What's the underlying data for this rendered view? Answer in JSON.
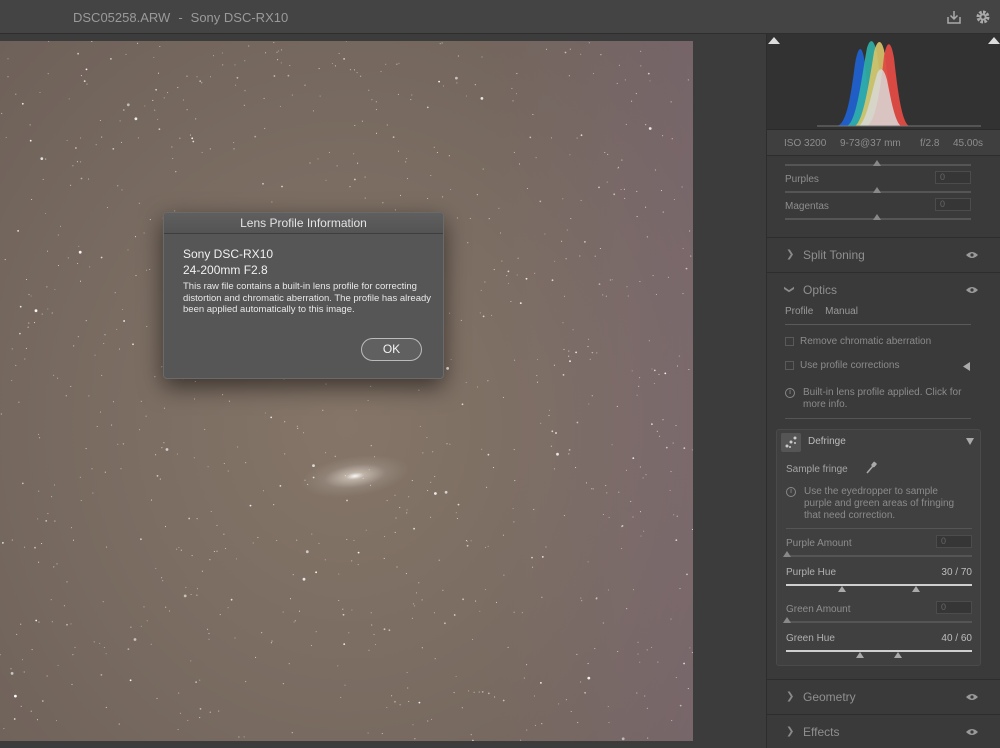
{
  "titlebar": {
    "filename": "DSC05258.ARW",
    "separator": "-",
    "camera": "Sony DSC-RX10",
    "export_icon": "export-icon",
    "settings_icon": "gear-icon"
  },
  "dialog": {
    "title": "Lens Profile Information",
    "camera": "Sony DSC-RX10",
    "lens": "24-200mm F2.8",
    "message": "This raw file contains a built-in lens profile for correcting distortion and chromatic aberration. The profile has already been applied automatically to this image.",
    "ok_label": "OK"
  },
  "exif": {
    "iso": "ISO 3200",
    "focal": "9-73@37 mm",
    "aperture": "f/2.8",
    "shutter": "45.00s"
  },
  "color_mixer": {
    "purples_label": "Purples",
    "purples_value": "0",
    "magentas_label": "Magentas",
    "magentas_value": "0"
  },
  "sections": {
    "split_toning": "Split Toning",
    "optics": "Optics",
    "geometry": "Geometry",
    "effects": "Effects"
  },
  "optics": {
    "tabs": [
      "Profile",
      "Manual"
    ],
    "remove_ca": "Remove chromatic aberration",
    "use_profile": "Use profile corrections",
    "builtin_info": "Built-in lens profile applied.  Click for more info."
  },
  "defringe": {
    "title": "Defringe",
    "sample_fringe": "Sample fringe",
    "eyedropper_info": "Use the eyedropper to sample purple and green areas of fringing that need correction.",
    "purple_amount_label": "Purple Amount",
    "purple_amount_value": "0",
    "purple_hue_label": "Purple Hue",
    "purple_hue_value": "30 / 70",
    "purple_hue_range": [
      30,
      70
    ],
    "green_amount_label": "Green Amount",
    "green_amount_value": "0",
    "green_hue_label": "Green Hue",
    "green_hue_value": "40 / 60",
    "green_hue_range": [
      40,
      60
    ]
  }
}
